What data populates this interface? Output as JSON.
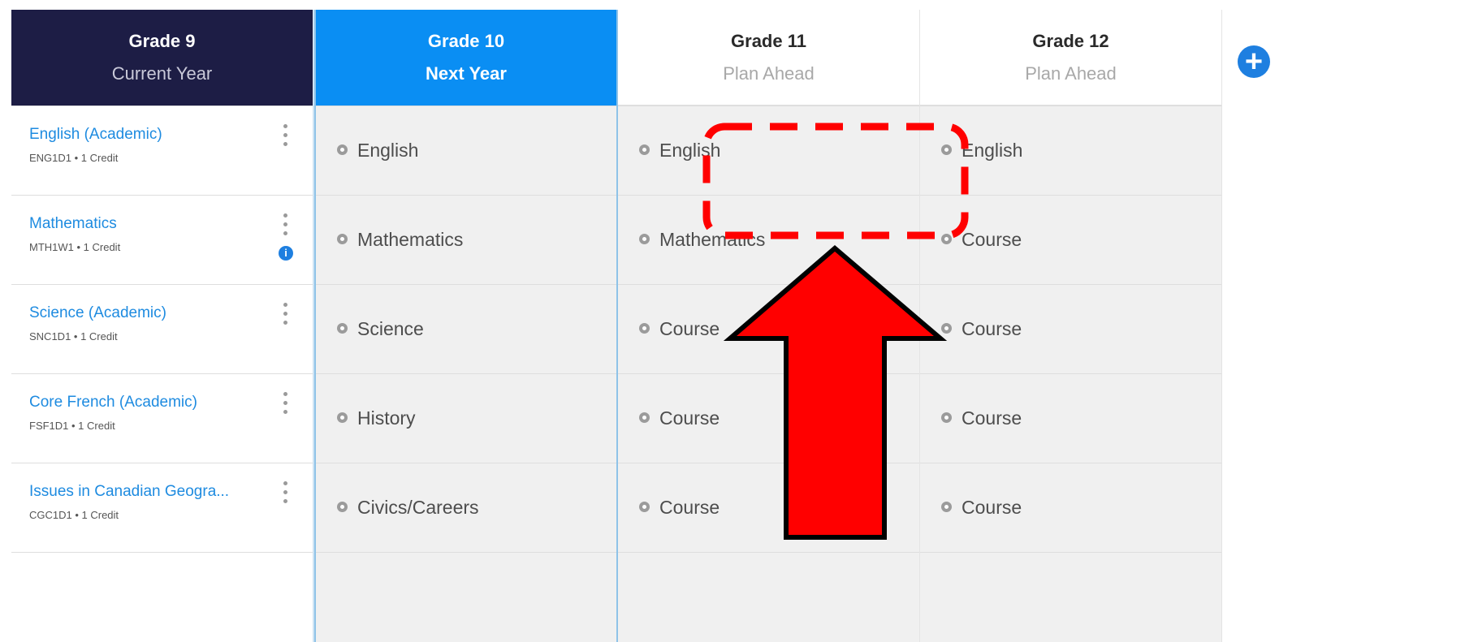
{
  "columns": [
    {
      "grade": "Grade 9",
      "subtitle": "Current Year"
    },
    {
      "grade": "Grade 10",
      "subtitle": "Next Year"
    },
    {
      "grade": "Grade 11",
      "subtitle": "Plan Ahead"
    },
    {
      "grade": "Grade 12",
      "subtitle": "Plan Ahead"
    }
  ],
  "grade9_courses": [
    {
      "name": "English (Academic)",
      "meta": "ENG1D1 • 1 Credit"
    },
    {
      "name": "Mathematics",
      "meta": "MTH1W1 • 1 Credit",
      "info": "i"
    },
    {
      "name": "Science (Academic)",
      "meta": "SNC1D1 • 1 Credit"
    },
    {
      "name": "Core French (Academic)",
      "meta": "FSF1D1 • 1 Credit"
    },
    {
      "name": "Issues in Canadian Geogra...",
      "meta": "CGC1D1 • 1 Credit"
    }
  ],
  "grade10_slots": [
    "English",
    "Mathematics",
    "Science",
    "History",
    "Civics/Careers"
  ],
  "grade11_slots": [
    "English",
    "Mathematics",
    "Course",
    "Course",
    "Course"
  ],
  "grade12_slots": [
    "English",
    "Course",
    "Course",
    "Course",
    "Course"
  ],
  "add_button": {
    "icon": "plus-icon",
    "label": "+"
  },
  "colors": {
    "current_year": "#1d1d45",
    "next_year": "#0a8ef3",
    "link": "#1e8be0",
    "annotation": "#ff0000"
  }
}
